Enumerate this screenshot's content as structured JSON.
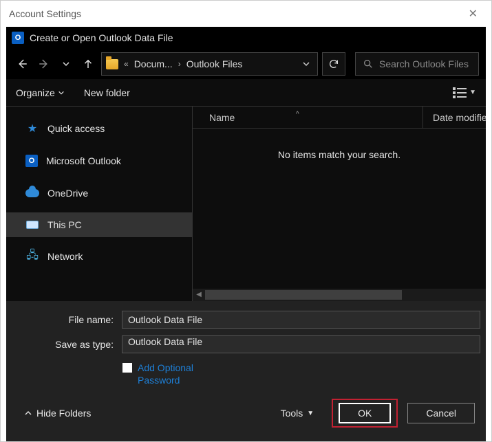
{
  "outer": {
    "title": "Account Settings"
  },
  "inner": {
    "title": "Create or Open Outlook Data File"
  },
  "path": {
    "crumb1": "Docum...",
    "crumb2": "Outlook Files"
  },
  "search": {
    "placeholder": "Search Outlook Files"
  },
  "toolbar": {
    "organize": "Organize",
    "new_folder": "New folder"
  },
  "sidebar": {
    "items": [
      {
        "label": "Quick access"
      },
      {
        "label": "Microsoft Outlook"
      },
      {
        "label": "OneDrive"
      },
      {
        "label": "This PC"
      },
      {
        "label": "Network"
      }
    ]
  },
  "columns": {
    "name": "Name",
    "date": "Date modified"
  },
  "empty_text": "No items match your search.",
  "form": {
    "filename_label": "File name:",
    "savetype_label": "Save as type:",
    "filename_value": "Outlook Data File",
    "savetype_value": "Outlook Data File",
    "addpass1": "Add Optional",
    "addpass2": "Password"
  },
  "bottom": {
    "hide_folders": "Hide Folders",
    "tools": "Tools",
    "ok": "OK",
    "cancel": "Cancel"
  }
}
